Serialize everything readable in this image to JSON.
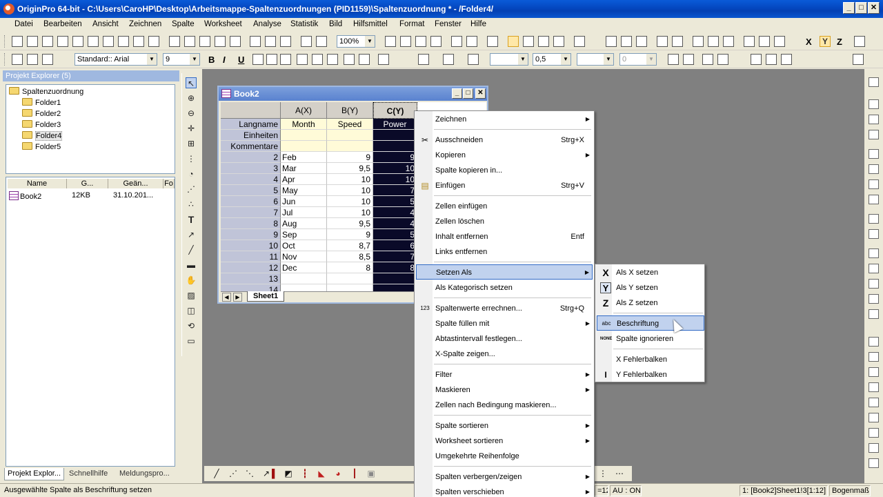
{
  "window": {
    "title": "OriginPro 64-bit - C:\\Users\\CaroHP\\Desktop\\Arbeitsmappe-Spaltenzuordnungen (PID1159)\\Spaltenzuordnung * - /Folder4/",
    "minimize": "_",
    "maximize": "□",
    "close": "✕"
  },
  "menubar": [
    "Datei",
    "Bearbeiten",
    "Ansicht",
    "Zeichnen",
    "Spalte",
    "Worksheet",
    "Analyse",
    "Statistik",
    "Bild",
    "Hilfsmittel",
    "Format",
    "Fenster",
    "Hilfe"
  ],
  "toolbar1": {
    "zoom": "100%"
  },
  "toolbar2": {
    "font": "Standard:: Arial",
    "font_size": "9",
    "bold": "B",
    "italic": "I",
    "underline": "U",
    "line_width": "0,5",
    "pattern_value": "0"
  },
  "explorer": {
    "header": "Projekt Explorer (5)",
    "root": "Spaltenzuordnung",
    "folders": [
      "Folder1",
      "Folder2",
      "Folder3",
      "Folder4",
      "Folder5"
    ],
    "selected_folder": "Folder4",
    "columns": [
      "Name",
      "G...",
      "Geän...",
      "Fo"
    ],
    "files": [
      {
        "name": "Book2",
        "size": "12KB",
        "modified": "31.10.201..."
      }
    ],
    "tabs": [
      "Projekt Explor...",
      "Schnellhilfe",
      "Meldungspro..."
    ]
  },
  "book2": {
    "title": "Book2",
    "col_headers": [
      "A(X)",
      "B(Y)",
      "C(Y)"
    ],
    "meta_rows": [
      "Langname",
      "Einheiten",
      "Kommentare"
    ],
    "longnames": [
      "Month",
      "Speed",
      "Power"
    ],
    "rows": [
      {
        "n": "2",
        "a": "Feb",
        "b": "9",
        "c": "9"
      },
      {
        "n": "3",
        "a": "Mar",
        "b": "9,5",
        "c": "10"
      },
      {
        "n": "4",
        "a": "Apr",
        "b": "10",
        "c": "10"
      },
      {
        "n": "5",
        "a": "May",
        "b": "10",
        "c": "7"
      },
      {
        "n": "6",
        "a": "Jun",
        "b": "10",
        "c": "5"
      },
      {
        "n": "7",
        "a": "Jul",
        "b": "10",
        "c": "4"
      },
      {
        "n": "8",
        "a": "Aug",
        "b": "9,5",
        "c": "4"
      },
      {
        "n": "9",
        "a": "Sep",
        "b": "9",
        "c": "5"
      },
      {
        "n": "10",
        "a": "Oct",
        "b": "8,7",
        "c": "6"
      },
      {
        "n": "11",
        "a": "Nov",
        "b": "8,5",
        "c": "7"
      },
      {
        "n": "12",
        "a": "Dec",
        "b": "8",
        "c": "8"
      },
      {
        "n": "13",
        "a": "",
        "b": "",
        "c": ""
      },
      {
        "n": "14",
        "a": "",
        "b": "",
        "c": ""
      }
    ],
    "sheet_tab": "Sheet1"
  },
  "context_menu": {
    "items": [
      {
        "label": "Zeichnen",
        "shortcut": "",
        "submenu": true
      },
      {
        "label": "Ausschneiden",
        "shortcut": "Strg+X",
        "submenu": false
      },
      {
        "label": "Kopieren",
        "shortcut": "",
        "submenu": true
      },
      {
        "label": "Spalte kopieren in...",
        "shortcut": "",
        "submenu": false
      },
      {
        "label": "Einfügen",
        "shortcut": "Strg+V",
        "submenu": false
      },
      {
        "label": "Zellen einfügen",
        "shortcut": "",
        "submenu": false
      },
      {
        "label": "Zellen löschen",
        "shortcut": "",
        "submenu": false
      },
      {
        "label": "Inhalt entfernen",
        "shortcut": "Entf",
        "submenu": false
      },
      {
        "label": "Links entfernen",
        "shortcut": "",
        "submenu": false
      },
      {
        "label": "Setzen Als",
        "shortcut": "",
        "submenu": true
      },
      {
        "label": "Als Kategorisch setzen",
        "shortcut": "",
        "submenu": false
      },
      {
        "label": "Spaltenwerte errechnen...",
        "shortcut": "Strg+Q",
        "submenu": false
      },
      {
        "label": "Spalte füllen mit",
        "shortcut": "",
        "submenu": true
      },
      {
        "label": "Abtastintervall festlegen...",
        "shortcut": "",
        "submenu": false
      },
      {
        "label": "X-Spalte zeigen...",
        "shortcut": "",
        "submenu": false
      },
      {
        "label": "Filter",
        "shortcut": "",
        "submenu": true
      },
      {
        "label": "Maskieren",
        "shortcut": "",
        "submenu": true
      },
      {
        "label": "Zellen nach Bedingung maskieren...",
        "shortcut": "",
        "submenu": false
      },
      {
        "label": "Spalte sortieren",
        "shortcut": "",
        "submenu": true
      },
      {
        "label": "Worksheet sortieren",
        "shortcut": "",
        "submenu": true
      },
      {
        "label": "Umgekehrte Reihenfolge",
        "shortcut": "",
        "submenu": false
      },
      {
        "label": "Spalten verbergen/zeigen",
        "shortcut": "",
        "submenu": true
      },
      {
        "label": "Spalten verschieben",
        "shortcut": "",
        "submenu": true
      }
    ],
    "highlighted": "Setzen Als"
  },
  "submenu": {
    "items": [
      {
        "label": "Als X setzen",
        "icon": "X"
      },
      {
        "label": "Als Y setzen",
        "icon": "Y"
      },
      {
        "label": "Als Z setzen",
        "icon": "Z"
      },
      {
        "label": "Beschriftung",
        "icon": "abc"
      },
      {
        "label": "Spalte ignorieren",
        "icon": "NONE"
      },
      {
        "label": "X Fehlerbalken",
        "icon": ""
      },
      {
        "label": "Y Fehlerbalken",
        "icon": "I"
      }
    ],
    "highlighted": "Beschriftung"
  },
  "statusbar": {
    "message": "Ausgewählte Spalte als Beschriftung setzen",
    "range_fragment": "=12",
    "au": "AU : ON",
    "location": "1: [Book2]Sheet1!3[1:12]",
    "angle": "Bogenmaß"
  },
  "colors": {
    "title_blue": "#0447c0",
    "selection": "#0a0a28",
    "meta_yellow": "#fffbd8",
    "menu_highlight": "#c1d2ee"
  }
}
